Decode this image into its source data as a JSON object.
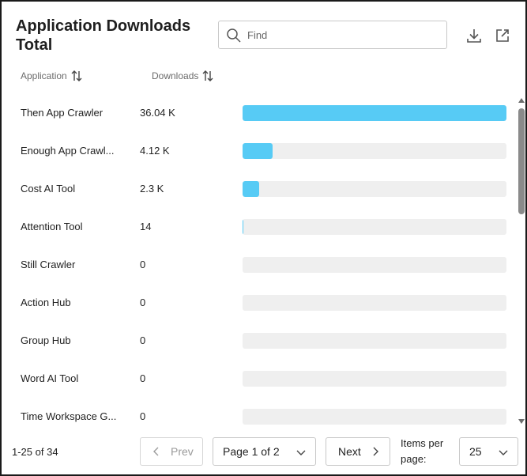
{
  "header": {
    "title": "Application Downloads Total",
    "search_placeholder": "Find",
    "download_icon": "download-icon",
    "popout_icon": "external-link-icon"
  },
  "columns": {
    "application": "Application",
    "downloads": "Downloads"
  },
  "rows": [
    {
      "name": "Then App Crawler",
      "value": "36.04 K",
      "fraction": 1.0
    },
    {
      "name": "Enough App Crawl...",
      "value": "4.12 K",
      "fraction": 0.114
    },
    {
      "name": "Cost AI Tool",
      "value": "2.3 K",
      "fraction": 0.064
    },
    {
      "name": "Attention Tool",
      "value": "14",
      "fraction": 0.0004
    },
    {
      "name": "Still Crawler",
      "value": "0",
      "fraction": 0
    },
    {
      "name": "Action Hub",
      "value": "0",
      "fraction": 0
    },
    {
      "name": "Group Hub",
      "value": "0",
      "fraction": 0
    },
    {
      "name": "Word AI Tool",
      "value": "0",
      "fraction": 0
    },
    {
      "name": "Time Workspace G...",
      "value": "0",
      "fraction": 0
    }
  ],
  "colors": {
    "bar_fill": "#57cbf5",
    "bar_track": "#efefef"
  },
  "pagination": {
    "range": "1-25 of 34",
    "prev_label": "Prev",
    "page_label": "Page 1 of 2",
    "next_label": "Next",
    "items_per_page_label": "Items per page:",
    "items_per_page_value": "25"
  }
}
